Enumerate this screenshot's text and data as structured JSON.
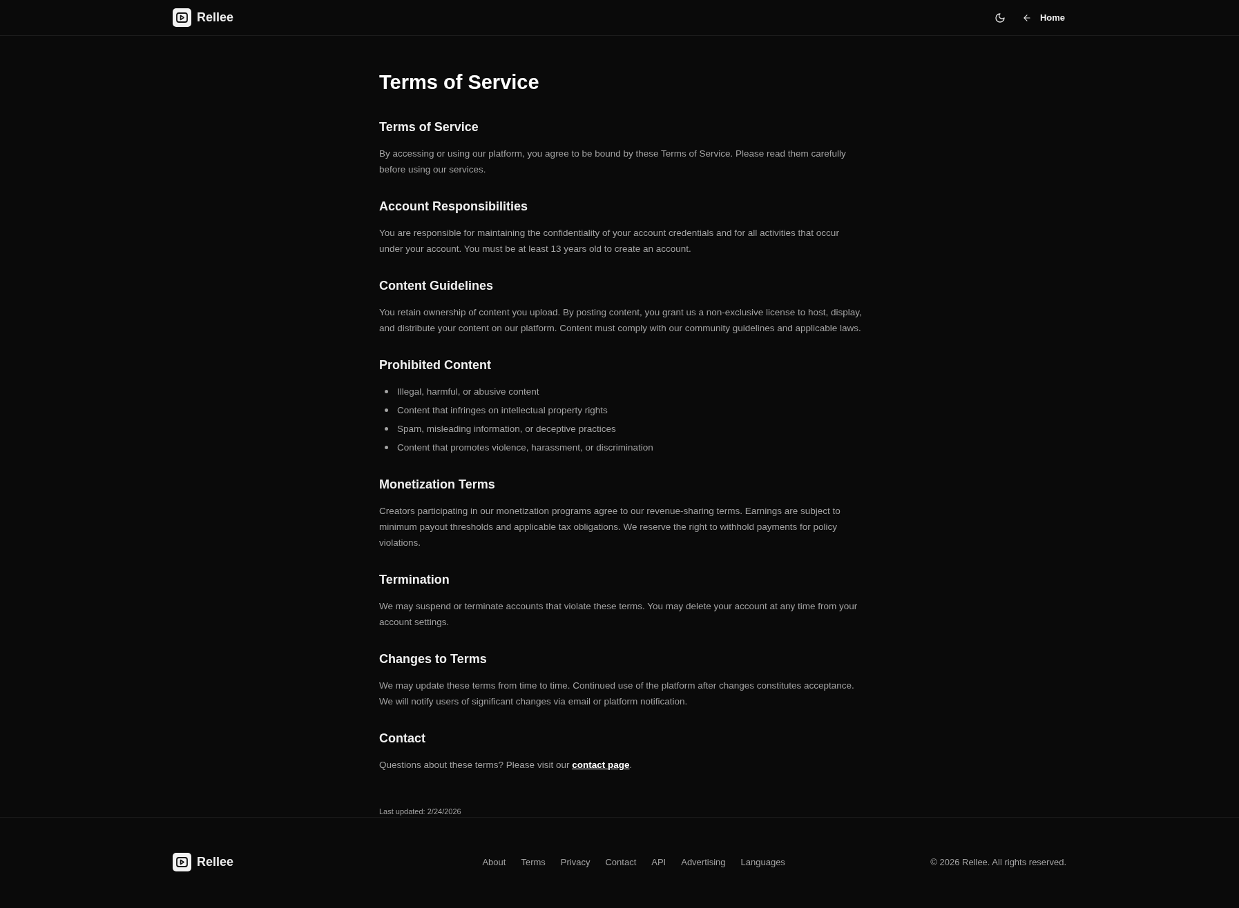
{
  "header": {
    "brand": "Rellee",
    "home_link": "Home"
  },
  "page_title": "Terms of Service",
  "sections": [
    {
      "kind": "text",
      "heading": "Terms of Service",
      "body": "By accessing or using our platform, you agree to be bound by these Terms of Service. Please read them carefully before using our services."
    },
    {
      "kind": "text",
      "heading": "Account Responsibilities",
      "body": "You are responsible for maintaining the confidentiality of your account credentials and for all activities that occur under your account. You must be at least 13 years old to create an account."
    },
    {
      "kind": "text",
      "heading": "Content Guidelines",
      "body": "You retain ownership of content you upload. By posting content, you grant us a non-exclusive license to host, display, and distribute your content on our platform. Content must comply with our community guidelines and applicable laws."
    },
    {
      "kind": "list",
      "heading": "Prohibited Content",
      "items": [
        "Illegal, harmful, or abusive content",
        "Content that infringes on intellectual property rights",
        "Spam, misleading information, or deceptive practices",
        "Content that promotes violence, harassment, or discrimination"
      ]
    },
    {
      "kind": "text",
      "heading": "Monetization Terms",
      "body": "Creators participating in our monetization programs agree to our revenue-sharing terms. Earnings are subject to minimum payout thresholds and applicable tax obligations. We reserve the right to withhold payments for policy violations."
    },
    {
      "kind": "text",
      "heading": "Termination",
      "body": "We may suspend or terminate accounts that violate these terms. You may delete your account at any time from your account settings."
    },
    {
      "kind": "text",
      "heading": "Changes to Terms",
      "body": "We may update these terms from time to time. Continued use of the platform after changes constitutes acceptance. We will notify users of significant changes via email or platform notification."
    },
    {
      "kind": "link",
      "heading": "Contact",
      "body": "Questions about these terms? Please visit our",
      "link": "contact page",
      "after": "."
    }
  ],
  "last_updated": "Last updated: 2/24/2026",
  "footer": {
    "brand": "Rellee",
    "links": [
      "About",
      "Terms",
      "Privacy",
      "Contact",
      "API",
      "Advertising",
      "Languages"
    ],
    "copyright": "© 2026 Rellee. All rights reserved."
  }
}
